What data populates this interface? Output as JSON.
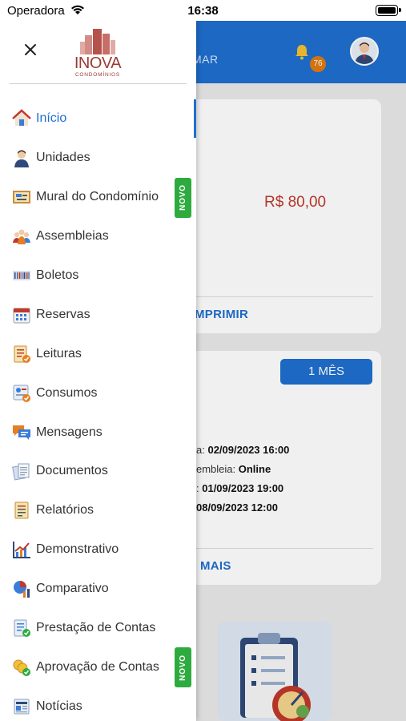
{
  "status_bar": {
    "carrier": "Operadora",
    "time": "16:38"
  },
  "background": {
    "header_tab": "MAR",
    "notification_count": "76",
    "card1": {
      "amount": "R$ 80,00",
      "action": "MPRIMIR"
    },
    "card2": {
      "period_button": "1 MÊS",
      "rows": [
        {
          "label": "a: ",
          "value": "02/09/2023 16:00"
        },
        {
          "label": "embleia: ",
          "value": "Online"
        },
        {
          "label": ": ",
          "value": "01/09/2023 19:00"
        },
        {
          "label": "",
          "value": "08/09/2023 12:00"
        }
      ],
      "action": "MAIS"
    }
  },
  "drawer": {
    "logo": {
      "brand": "INOVA",
      "subtitle": "CONDOMÍNIOS"
    },
    "badge_label": "NOVO",
    "items": [
      {
        "label": "Início",
        "icon": "home-icon",
        "active": true
      },
      {
        "label": "Unidades",
        "icon": "user-icon"
      },
      {
        "label": "Mural do Condomínio",
        "icon": "bulletin-board-icon",
        "badge": true
      },
      {
        "label": "Assembleias",
        "icon": "group-icon"
      },
      {
        "label": "Boletos",
        "icon": "barcode-icon"
      },
      {
        "label": "Reservas",
        "icon": "calendar-icon"
      },
      {
        "label": "Leituras",
        "icon": "clipboard-check-icon"
      },
      {
        "label": "Consumos",
        "icon": "meter-icon"
      },
      {
        "label": "Mensagens",
        "icon": "chat-bubbles-icon"
      },
      {
        "label": "Documentos",
        "icon": "documents-icon"
      },
      {
        "label": "Relatórios",
        "icon": "report-icon"
      },
      {
        "label": "Demonstrativo",
        "icon": "line-chart-icon"
      },
      {
        "label": "Comparativo",
        "icon": "pie-chart-icon"
      },
      {
        "label": "Prestação de Contas",
        "icon": "accounts-document-icon"
      },
      {
        "label": "Aprovação de Contas",
        "icon": "coins-approval-icon",
        "badge": true
      },
      {
        "label": "Notícias",
        "icon": "newspaper-icon"
      }
    ]
  },
  "colors": {
    "primary": "#1e6fd0",
    "badge_green": "#2eab3f",
    "brand": "#9b3b34",
    "amount_red": "#c0392b"
  }
}
